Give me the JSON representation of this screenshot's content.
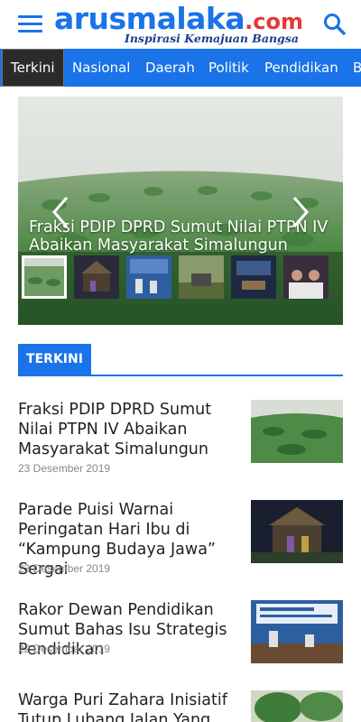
{
  "header": {
    "logo_main": "arusmalaka",
    "logo_suffix": ".com",
    "tagline": "Inspirasi Kemajuan Bangsa"
  },
  "nav": {
    "items": [
      {
        "label": "Terkini"
      },
      {
        "label": "Nasional"
      },
      {
        "label": "Daerah"
      },
      {
        "label": "Politik"
      },
      {
        "label": "Pendidikan"
      },
      {
        "label": "B"
      }
    ]
  },
  "slider": {
    "title": "Fraksi PDIP DPRD Sumut Nilai PTPN IV Abaikan Masyarakat Simalungun"
  },
  "section": {
    "label": "TERKINI"
  },
  "articles": [
    {
      "title": "Fraksi PDIP DPRD Sumut Nilai PTPN IV Abaikan Masyarakat Simalungun",
      "date": "23 Desember 2019"
    },
    {
      "title": "Parade Puisi Warnai Peringatan Hari Ibu di “Kampung Budaya Jawa” Sergai",
      "date": "23 Desember 2019"
    },
    {
      "title": "Rakor Dewan Pendidikan Sumut Bahas Isu Strategis Pendidikan",
      "date": "22 Desember 2019"
    },
    {
      "title": "Warga Puri Zahara Inisiatif Tutup Lubang Jalan Yang Rusak",
      "date": ""
    }
  ],
  "colors": {
    "brand_blue": "#1a73e8",
    "brand_red": "#e53935",
    "active_tab_bg": "#2b2b2b"
  }
}
